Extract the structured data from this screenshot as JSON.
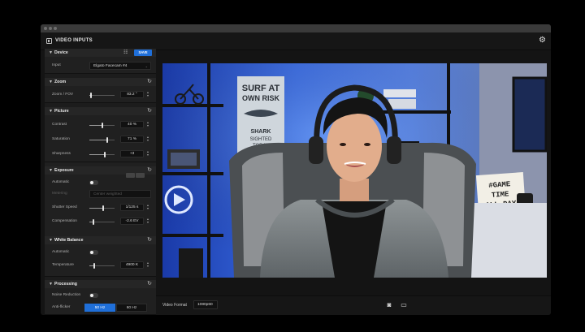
{
  "app": {
    "title": "VIDEO INPUTS",
    "icon": "panel-icon",
    "settings_icon": "gear-icon"
  },
  "colors": {
    "accent": "#1f6fd9",
    "window_bg": "#141414",
    "panel_bg": "#1c1c1c",
    "ambient_light": "#3b6ee6"
  },
  "sections": {
    "device": {
      "title": "Device",
      "save_label": "SAVE",
      "input_label": "Input",
      "input_value": "Elgato Facecam #4"
    },
    "zoom": {
      "title": "Zoom",
      "zoom_label": "Zoom / FOV",
      "zoom_value": "83.2 °",
      "zoom_fraction": 0.08
    },
    "picture": {
      "title": "Picture",
      "contrast_label": "Contrast",
      "contrast_value": "40 %",
      "contrast_fraction": 0.52,
      "saturation_label": "Saturation",
      "saturation_value": "71 %",
      "saturation_fraction": 0.71,
      "sharpness_label": "Sharpness",
      "sharpness_value": "+3",
      "sharpness_fraction": 0.62
    },
    "exposure": {
      "title": "Exposure",
      "automatic_label": "Automatic",
      "metering_label": "Metering",
      "metering_value": "Center weighted",
      "shutter_label": "Shutter Speed",
      "shutter_value": "1/125 s",
      "shutter_fraction": 0.55,
      "compensation_label": "Compensation",
      "compensation_value": "-2.6 EV",
      "compensation_fraction": 0.15
    },
    "white_balance": {
      "title": "White Balance",
      "automatic_label": "Automatic",
      "temperature_label": "Temperature",
      "temperature_value": "4900 K",
      "temperature_fraction": 0.2
    },
    "processing": {
      "title": "Processing",
      "noise_label": "Noise Reduction",
      "antiflicker_label": "Anti-flicker",
      "option_50": "50 Hz",
      "option_60": "60 Hz"
    }
  },
  "bottom": {
    "video_format_label": "Video Format",
    "video_format_value": "1080p60"
  },
  "preview": {
    "poster_text": "SURF AT\nOWN RISK",
    "poster_sub": "SHARK\nSIGHTED\nTODAY",
    "lightbox_line1": "#GAME",
    "lightbox_line2": "TIME",
    "lightbox_line3": "ALL DAY",
    "lightbox_line4": "VIT D"
  }
}
